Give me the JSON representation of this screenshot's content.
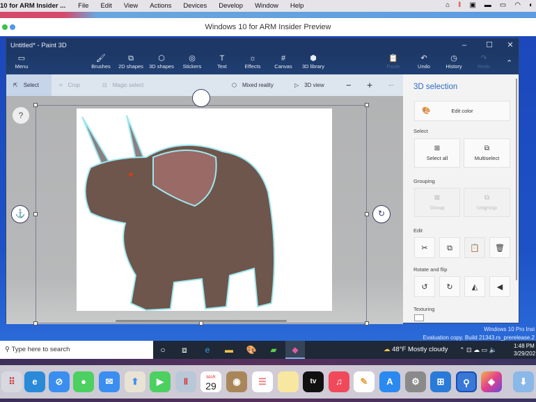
{
  "mac_menubar": {
    "app": "10 for ARM Insider ...",
    "items": [
      "File",
      "Edit",
      "View",
      "Actions",
      "Devices",
      "Develop",
      "Window",
      "Help"
    ]
  },
  "parallels": {
    "title": "Windows 10 for ARM Insider Preview"
  },
  "paint3d": {
    "title": "Untitled* - Paint 3D",
    "ribbon": [
      {
        "label": "Menu",
        "icon": "menu-icon"
      },
      {
        "label": "Brushes",
        "icon": "brush-icon"
      },
      {
        "label": "2D shapes",
        "icon": "2d-shapes-icon"
      },
      {
        "label": "3D shapes",
        "icon": "3d-shapes-icon"
      },
      {
        "label": "Stickers",
        "icon": "sticker-icon"
      },
      {
        "label": "Text",
        "icon": "text-icon"
      },
      {
        "label": "Effects",
        "icon": "effects-icon"
      },
      {
        "label": "Canvas",
        "icon": "canvas-icon"
      },
      {
        "label": "3D library",
        "icon": "3d-library-icon"
      },
      {
        "label": "Paste",
        "icon": "paste-icon",
        "disabled": true
      },
      {
        "label": "Undo",
        "icon": "undo-icon"
      },
      {
        "label": "History",
        "icon": "history-icon"
      },
      {
        "label": "Redo",
        "icon": "redo-icon",
        "disabled": true
      }
    ],
    "subtoolbar": {
      "select": "Select",
      "crop": "Crop",
      "magic_select": "Magic select",
      "mixed_reality": "Mixed reality",
      "view_3d": "3D view",
      "zoom_out": "−",
      "zoom_in": "+",
      "more": "···"
    },
    "help": "?",
    "panel": {
      "title": "3D selection",
      "edit_color": "Edit color",
      "select_label": "Select",
      "select_all": "Select all",
      "multiselect": "Multiselect",
      "grouping_label": "Grouping",
      "group": "Group",
      "ungroup": "Ungroup",
      "edit_label": "Edit",
      "rotate_label": "Rotate and flip",
      "texturing_label": "Texturing"
    },
    "accent": "#2b6cc4"
  },
  "watermark": {
    "line1": "Windows 10 Pro Insi",
    "line2": "Evaluation copy. Build 21343.rs_prerelease.2"
  },
  "taskbar": {
    "search_placeholder": "Type here to search",
    "weather": "48°F  Mostly cloudy",
    "time": "1:48 PM",
    "date": "3/29/202"
  },
  "dock": {
    "calendar_month": "MAR",
    "calendar_day": "29",
    "tv": "tv"
  }
}
